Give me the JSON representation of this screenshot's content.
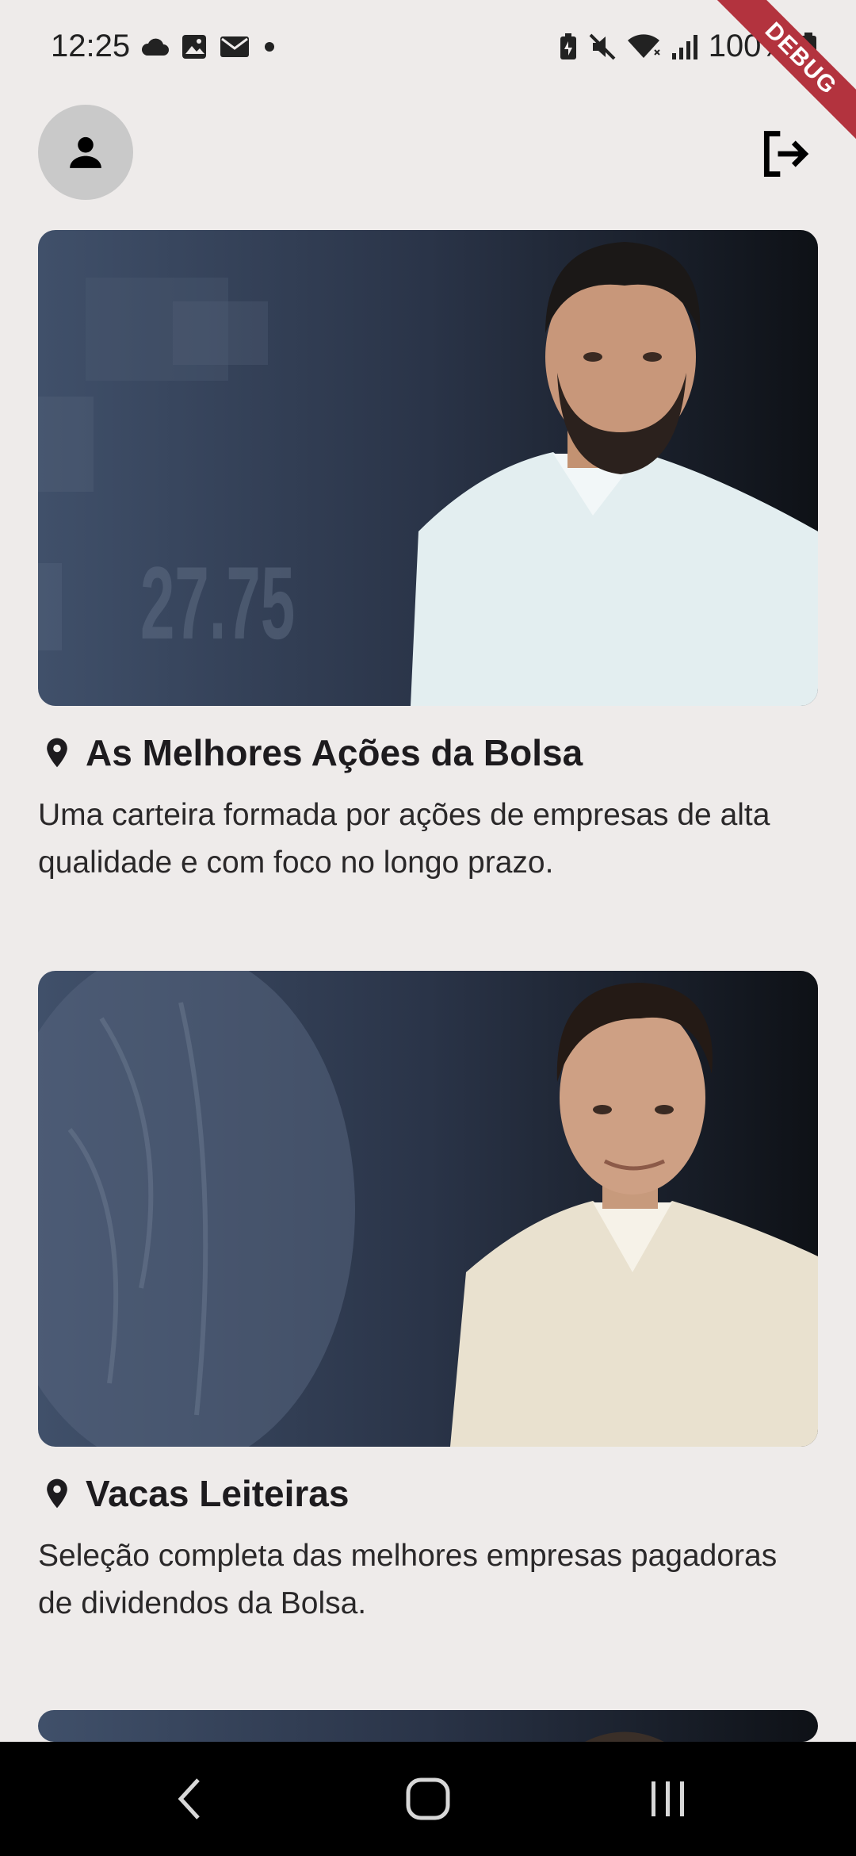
{
  "status_bar": {
    "time": "12:25",
    "battery": "100%",
    "left_icons": [
      "cloud-icon",
      "image-icon",
      "mail-icon",
      "dot-icon"
    ],
    "right_icons": [
      "battery-saver-icon",
      "mute-icon",
      "wifi-icon",
      "signal-icon",
      "battery-icon"
    ]
  },
  "debug_banner": "DEBUG",
  "header": {
    "profile_icon": "person-icon",
    "logout_icon": "logout-icon"
  },
  "cards": [
    {
      "title": "As Melhores Ações da Bolsa",
      "description": "Uma carteira formada por ações de empresas de alta qualidade e com foco no longo prazo.",
      "image_overlay_text": "27.75"
    },
    {
      "title": "Vacas Leiteiras",
      "description": "Seleção completa das melhores empresas pagadoras de dividendos da Bolsa."
    }
  ],
  "nav_bar": {
    "back_icon": "back-icon",
    "home_icon": "home-icon",
    "recents_icon": "recents-icon"
  }
}
